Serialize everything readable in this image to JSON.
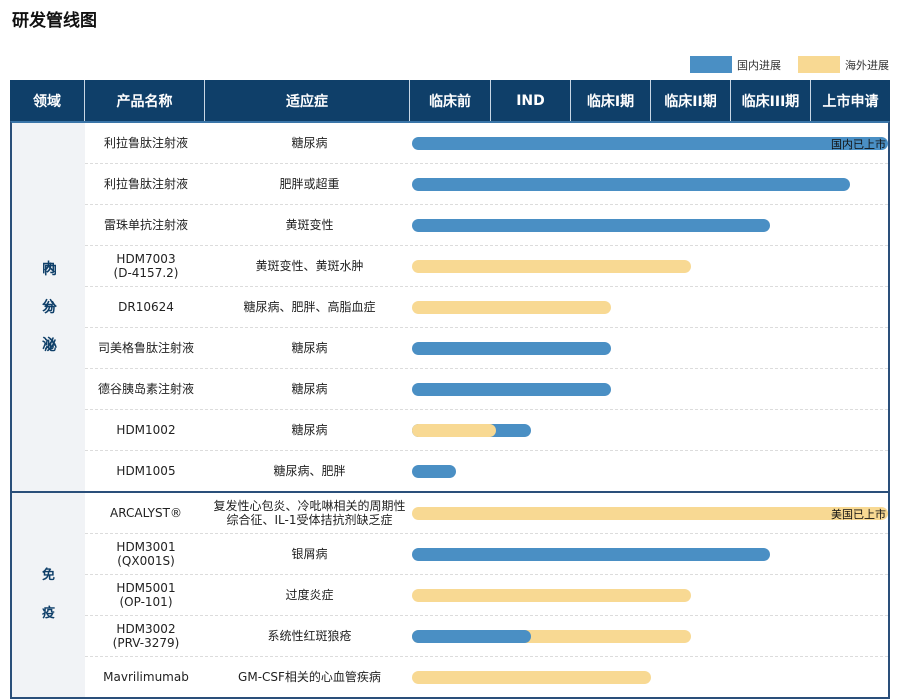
{
  "title": "研发管线图",
  "legend": [
    {
      "label": "国内进展",
      "color": "#4a8fc4"
    },
    {
      "label": "海外进展",
      "color": "#f8d993"
    }
  ],
  "headers": [
    "领域",
    "产品名称",
    "适应症",
    "临床前",
    "IND",
    "临床I期",
    "临床II期",
    "临床III期",
    "上市申请"
  ],
  "chart_data": {
    "type": "table",
    "stages": [
      "临床前",
      "IND",
      "临床I期",
      "临床II期",
      "临床III期",
      "上市申请"
    ],
    "progress_unit": "stages completed (0-6)",
    "sections": [
      {
        "area": "内分泌",
        "area_chars": [
          "内",
          "分",
          "泌"
        ],
        "rows": [
          {
            "product": "利拉鲁肽注射液",
            "indication": "糖尿病",
            "domestic": 6,
            "overseas": null,
            "note": "国内已上市"
          },
          {
            "product": "利拉鲁肽注射液",
            "indication": "肥胖或超重",
            "domestic": 5.5,
            "overseas": null,
            "note": ""
          },
          {
            "product": "雷珠单抗注射液",
            "indication": "黄斑变性",
            "domestic": 4.5,
            "overseas": null,
            "note": ""
          },
          {
            "product": "HDM7003\n(D-4157.2)",
            "indication": "黄斑变性、黄斑水肿",
            "domestic": null,
            "overseas": 3.5,
            "note": ""
          },
          {
            "product": "DR10624",
            "indication": "糖尿病、肥胖、高脂血症",
            "domestic": null,
            "overseas": 2.5,
            "note": ""
          },
          {
            "product": "司美格鲁肽注射液",
            "indication": "糖尿病",
            "domestic": 2.5,
            "overseas": null,
            "note": ""
          },
          {
            "product": "德谷胰岛素注射液",
            "indication": "糖尿病",
            "domestic": 2.5,
            "overseas": null,
            "note": ""
          },
          {
            "product": "HDM1002",
            "indication": "糖尿病",
            "domestic": 1.5,
            "overseas": 1.05,
            "note": ""
          },
          {
            "product": "HDM1005",
            "indication": "糖尿病、肥胖",
            "domestic": 0.55,
            "overseas": null,
            "note": ""
          }
        ]
      },
      {
        "area": "免疫",
        "area_chars": [
          "免",
          "疫"
        ],
        "rows": [
          {
            "product": "ARCALYST®",
            "indication": "复发性心包炎、冷吡啉相关的周期性综合征、IL-1受体拮抗剂缺乏症",
            "domestic": null,
            "overseas": 6,
            "note": "美国已上市"
          },
          {
            "product": "HDM3001\n(QX001S)",
            "indication": "银屑病",
            "domestic": 4.5,
            "overseas": null,
            "note": ""
          },
          {
            "product": "HDM5001\n(OP-101)",
            "indication": "过度炎症",
            "domestic": null,
            "overseas": 3.5,
            "note": ""
          },
          {
            "product": "HDM3002\n(PRV-3279)",
            "indication": "系统性红斑狼疮",
            "domestic": 1.5,
            "overseas": 3.5,
            "note": ""
          },
          {
            "product": "Mavrilimumab",
            "indication": "GM-CSF相关的心血管疾病",
            "domestic": null,
            "overseas": 3.0,
            "note": ""
          }
        ]
      }
    ]
  }
}
